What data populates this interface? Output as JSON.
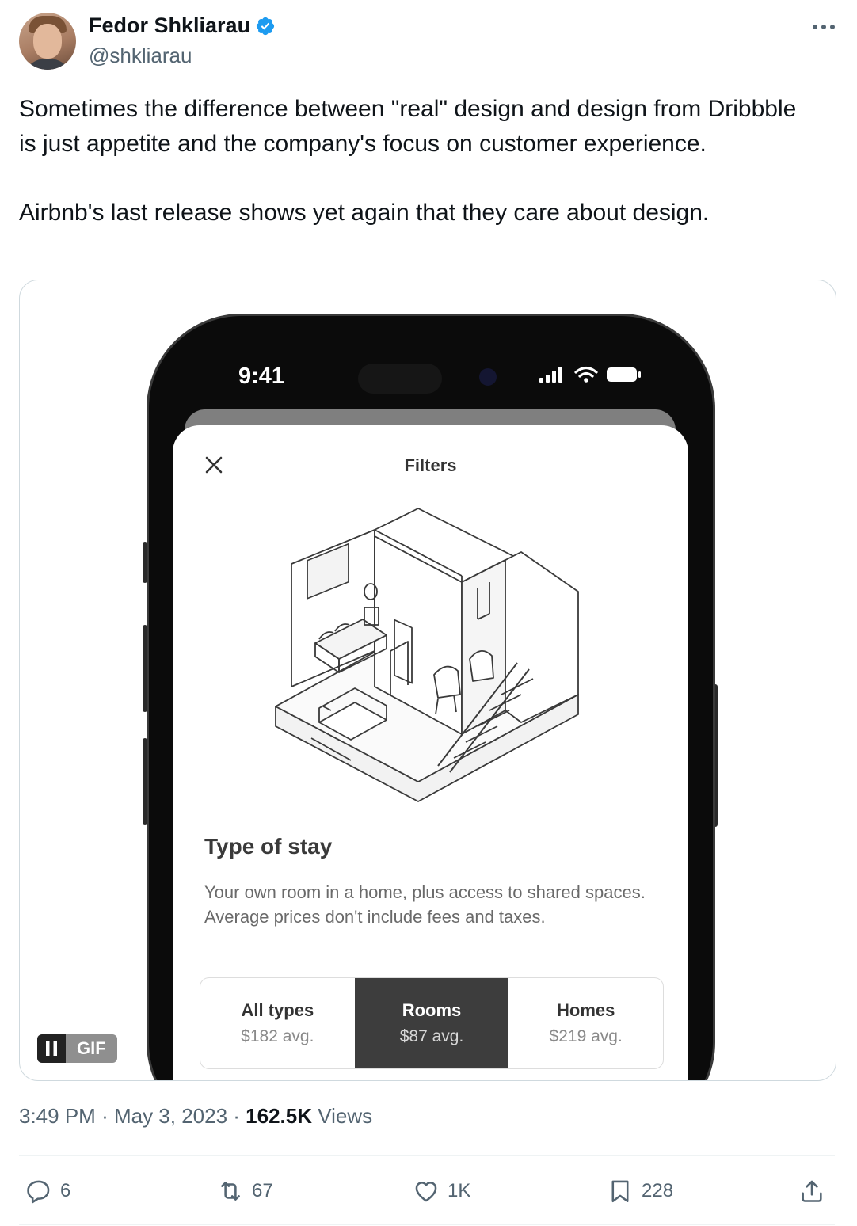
{
  "author": {
    "name": "Fedor Shkliarau",
    "handle": "@shkliarau",
    "verified": true
  },
  "tweet": {
    "paragraphs": [
      "Sometimes the difference between \"real\" design and design from Dribbble is just appetite and the company's focus on customer experience.",
      "Airbnb's last release shows yet again that they care about design."
    ]
  },
  "media": {
    "type": "gif",
    "gif_label": "GIF",
    "phone": {
      "status_time": "9:41",
      "sheet_title": "Filters",
      "section_title": "Type of stay",
      "section_description": "Your own room in a home, plus access to shared spaces. Average prices don't include fees and taxes.",
      "segments": [
        {
          "label": "All types",
          "price": "$182 avg.",
          "selected": false
        },
        {
          "label": "Rooms",
          "price": "$87 avg.",
          "selected": true
        },
        {
          "label": "Homes",
          "price": "$219 avg.",
          "selected": false
        }
      ]
    }
  },
  "meta": {
    "time": "3:49 PM",
    "date": "May 3, 2023",
    "views_count": "162.5K",
    "views_label": "Views"
  },
  "actions": {
    "replies": "6",
    "reposts": "67",
    "likes": "1K",
    "bookmarks": "228"
  },
  "colors": {
    "verified_blue": "#1d9bf0",
    "secondary_text": "#536471",
    "primary_text": "#0f1419",
    "selected_segment": "#3d3d3d"
  }
}
